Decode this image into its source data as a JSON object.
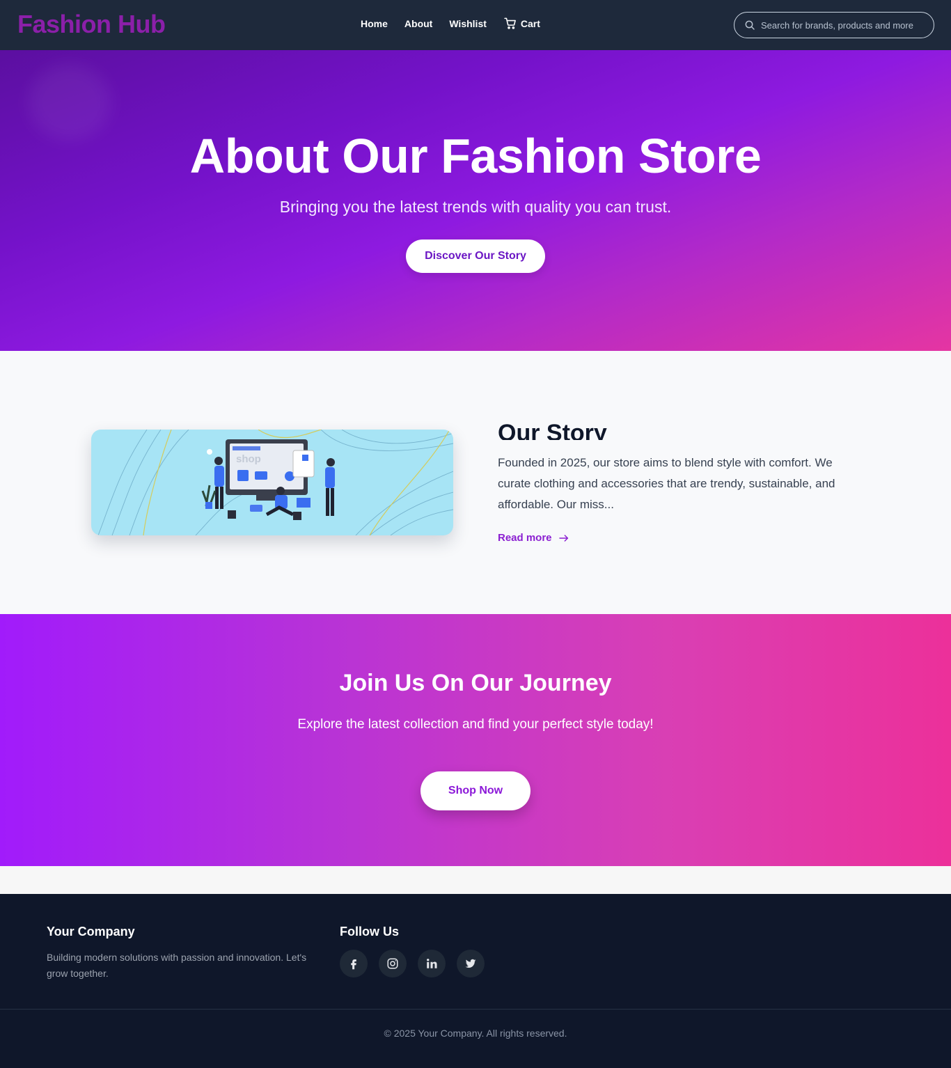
{
  "header": {
    "logo": "Fashion Hub",
    "nav": [
      {
        "label": "Home"
      },
      {
        "label": "About"
      },
      {
        "label": "Wishlist"
      },
      {
        "label": "Cart",
        "icon": "cart-icon"
      }
    ],
    "search": {
      "placeholder": "Search for brands, products and more",
      "value": "",
      "icon": "search-icon"
    }
  },
  "hero": {
    "title": "About Our Fashion Store",
    "subtitle": "Bringing you the latest trends with quality you can trust.",
    "button": "Discover Our Story"
  },
  "story": {
    "title": "Our Story",
    "text": "Founded in 2025, our store aims to blend style with comfort. We curate clothing and accessories that are trendy, sustainable, and affordable. Our miss...",
    "read_more": "Read more",
    "illustration_label": "shop"
  },
  "join": {
    "title": "Join Us On Our Journey",
    "subtitle": "Explore the latest collection and find your perfect style today!",
    "button": "Shop Now"
  },
  "footer": {
    "company": "Your Company",
    "description": "Building modern solutions with passion and innovation. Let's grow together.",
    "follow": "Follow Us",
    "socials": [
      "facebook-icon",
      "instagram-icon",
      "linkedin-icon",
      "twitter-icon"
    ],
    "copyright": "© 2025 Your Company. All rights reserved."
  },
  "colors": {
    "header_bg": "#1e293b",
    "logo": "#8b1fa9",
    "accent": "#8b1fd1",
    "footer_bg": "#0f172a",
    "hero_gradient_start": "#5b0fa0",
    "hero_gradient_end": "#e535a2"
  }
}
